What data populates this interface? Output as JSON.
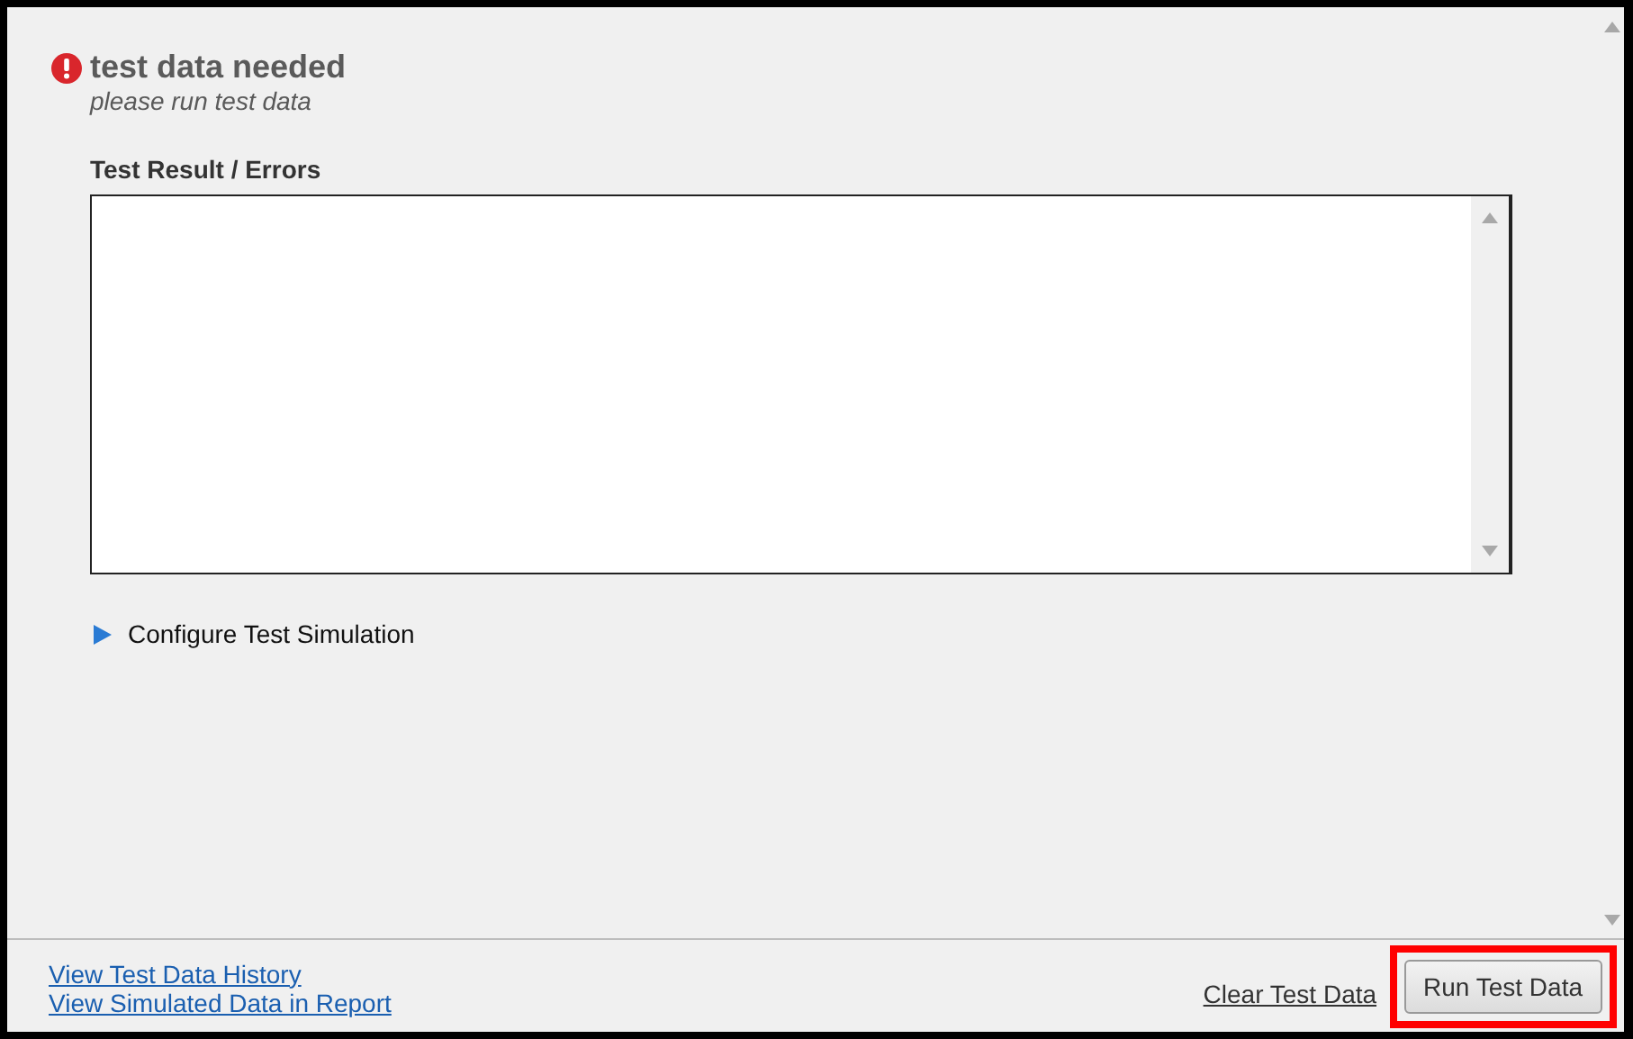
{
  "status": {
    "kind": "error",
    "title": "test data needed",
    "message": "please run test data"
  },
  "results": {
    "label": "Test Result / Errors"
  },
  "configure": {
    "label": "Configure Test Simulation",
    "expanded": false
  },
  "footer": {
    "links": [
      "View Test Data History",
      "View Simulated Data in Report"
    ],
    "clear_link": "Clear Test Data",
    "run_button": {
      "label": "Run Test Data",
      "highlighted": true
    }
  }
}
